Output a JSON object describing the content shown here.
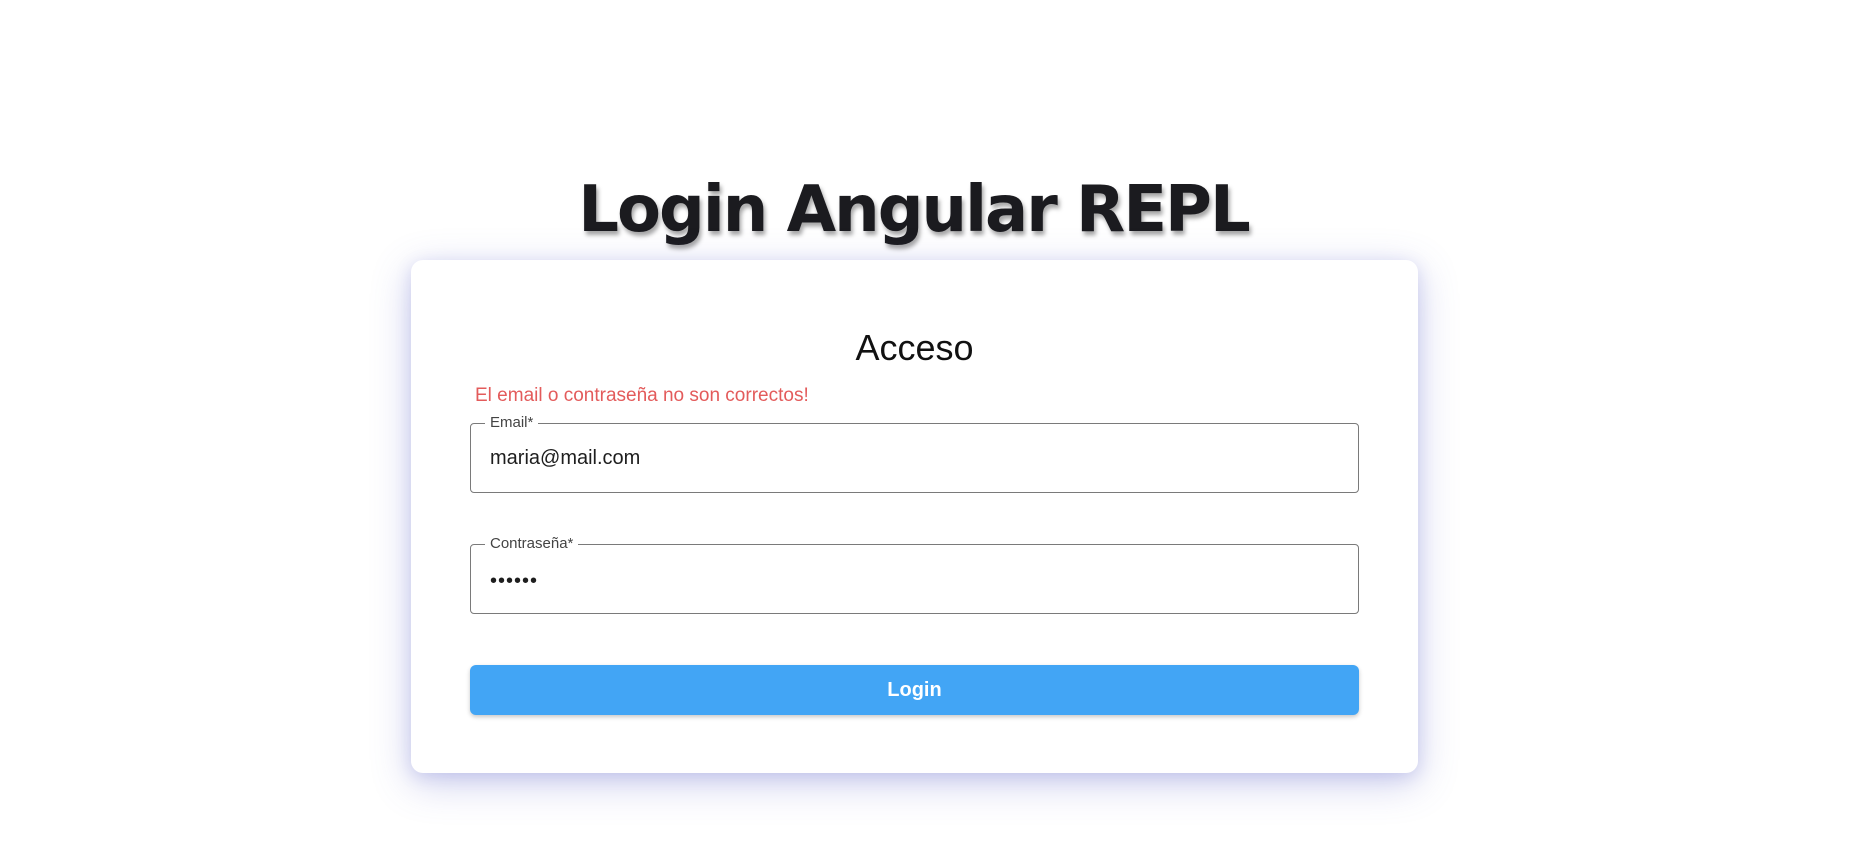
{
  "page": {
    "title": "Login Angular REPL"
  },
  "card": {
    "title": "Acceso",
    "error": "El email o contraseña no son correctos!",
    "email": {
      "label": "Email*",
      "value": "maria@mail.com"
    },
    "password": {
      "label": "Contraseña*",
      "value": "••••••"
    },
    "login_label": "Login"
  },
  "colors": {
    "error": "#e35b5b",
    "button": "#42a5f5",
    "title": "#1b1b1f"
  }
}
